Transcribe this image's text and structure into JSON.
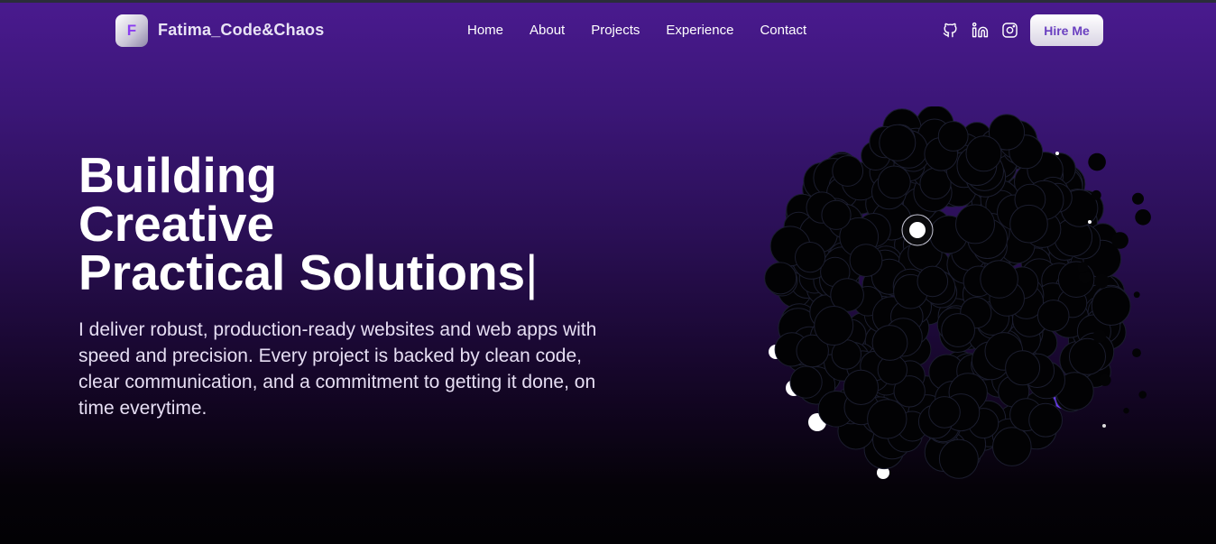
{
  "brand": {
    "logo_letter": "F",
    "name": "Fatima_Code&Chaos"
  },
  "nav": {
    "items": [
      {
        "label": "Home"
      },
      {
        "label": "About"
      },
      {
        "label": "Projects"
      },
      {
        "label": "Experience"
      },
      {
        "label": "Contact"
      }
    ]
  },
  "socials": {
    "icons": [
      "github-icon",
      "linkedin-icon",
      "instagram-icon"
    ]
  },
  "hire_button": {
    "label": "Hire Me"
  },
  "hero": {
    "title_lines": [
      "Building",
      "Creative",
      "Practical Solutions"
    ],
    "cursor": "|",
    "description": "I deliver robust, production-ready websites and web apps with speed and precision. Every project is backed by clean code, clear communication, and a commitment to getting it done, on time everytime."
  },
  "colors": {
    "accent": "#8a3cf0",
    "background_top": "#4a1a8f",
    "background_bottom": "#020104",
    "text": "#ffffff"
  }
}
